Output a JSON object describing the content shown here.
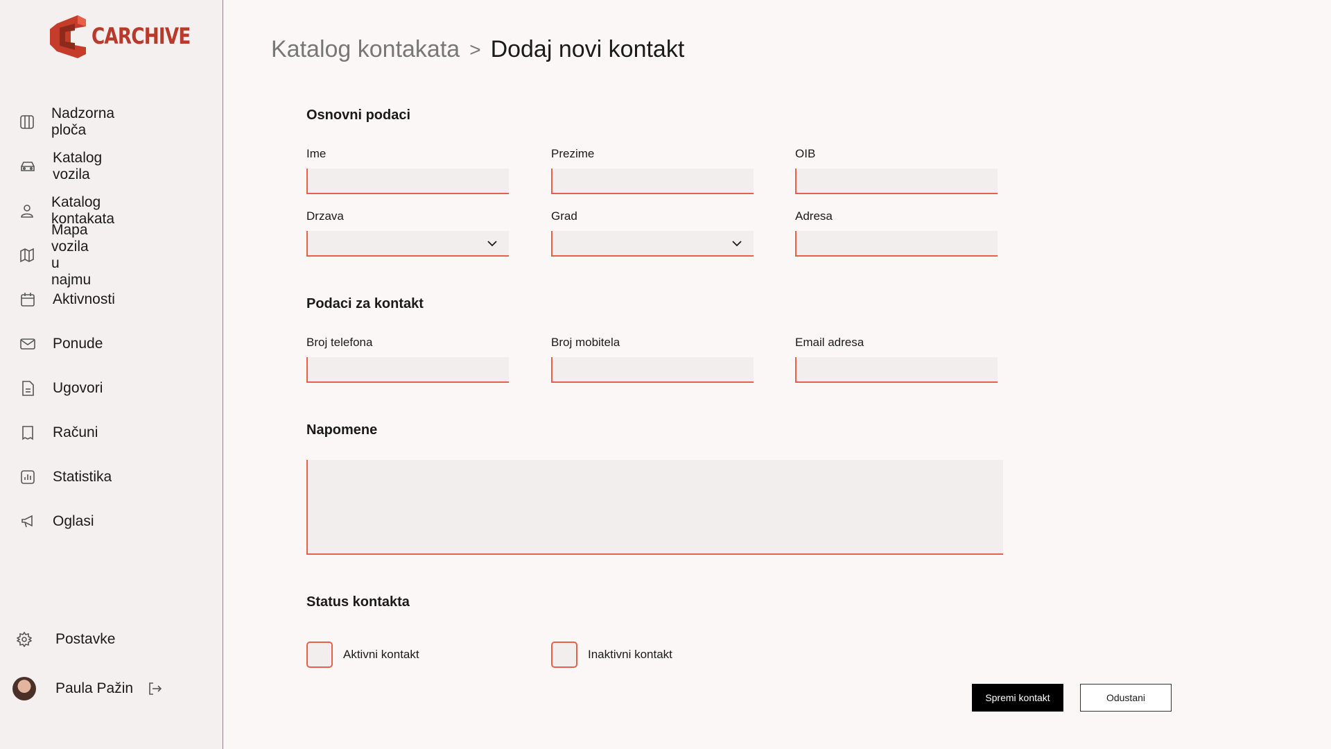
{
  "app": {
    "logo_text": "CARCHIVE",
    "brand_color": "#b73a2a",
    "accent_color": "#e8604a"
  },
  "sidebar": {
    "items": [
      {
        "label": "Nadzorna ploča",
        "icon": "dashboard-icon"
      },
      {
        "label": "Katalog vozila",
        "icon": "car-icon"
      },
      {
        "label": "Katalog kontakata",
        "icon": "user-icon"
      },
      {
        "label": "Mapa vozila u najmu",
        "icon": "map-icon"
      },
      {
        "label": "Aktivnosti",
        "icon": "calendar-icon"
      },
      {
        "label": "Ponude",
        "icon": "mail-icon"
      },
      {
        "label": "Ugovori",
        "icon": "document-icon"
      },
      {
        "label": "Računi",
        "icon": "receipt-icon"
      },
      {
        "label": "Statistika",
        "icon": "chart-icon"
      },
      {
        "label": "Oglasi",
        "icon": "megaphone-icon"
      }
    ],
    "settings_label": "Postavke",
    "user_name": "Paula Pažin"
  },
  "breadcrumb": {
    "parent": "Katalog kontakata",
    "separator": ">",
    "current": "Dodaj novi kontakt"
  },
  "sections": {
    "basic": "Osnovni podaci",
    "contact": "Podaci za kontakt",
    "notes": "Napomene",
    "status": "Status kontakta"
  },
  "fields": {
    "ime": {
      "label": "Ime",
      "value": ""
    },
    "prezime": {
      "label": "Prezime",
      "value": ""
    },
    "oib": {
      "label": "OIB",
      "value": ""
    },
    "drzava": {
      "label": "Drzava",
      "value": ""
    },
    "grad": {
      "label": "Grad",
      "value": ""
    },
    "adresa": {
      "label": "Adresa",
      "value": ""
    },
    "telefon": {
      "label": "Broj telefona",
      "value": ""
    },
    "mobitel": {
      "label": "Broj mobitela",
      "value": ""
    },
    "email": {
      "label": "Email adresa",
      "value": ""
    }
  },
  "status_options": {
    "active": "Aktivni kontakt",
    "inactive": "Inaktivni kontakt"
  },
  "buttons": {
    "save": "Spremi kontakt",
    "cancel": "Odustani"
  }
}
